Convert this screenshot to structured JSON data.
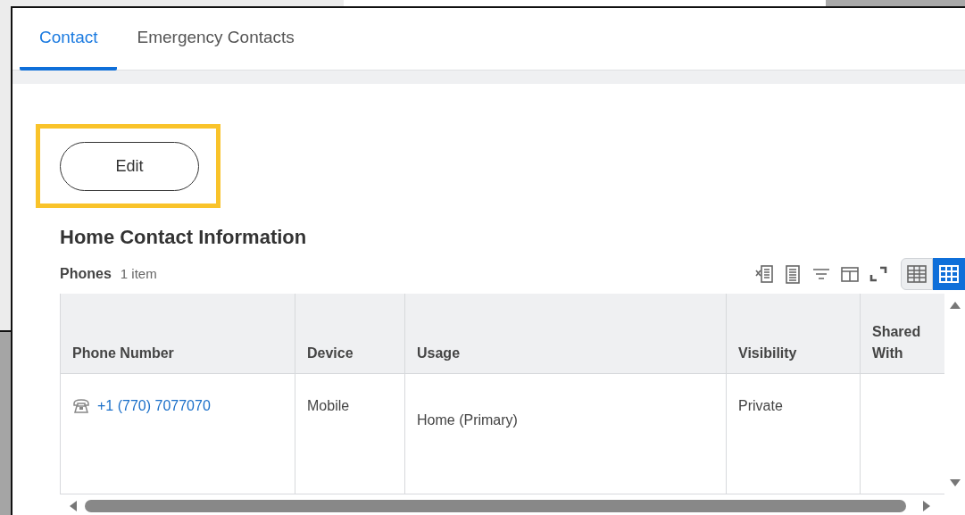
{
  "tabs": [
    {
      "label": "Contact",
      "selected": true
    },
    {
      "label": "Emergency Contacts",
      "selected": false
    }
  ],
  "edit_button": {
    "label": "Edit",
    "highlighted": true
  },
  "section": {
    "title": "Home Contact Information"
  },
  "phones": {
    "label": "Phones",
    "count": "1 item",
    "view_toggle": [
      {
        "kind": "list",
        "selected": false
      },
      {
        "kind": "grid",
        "selected": true
      }
    ],
    "table": {
      "columns": [
        "Phone Number",
        "Device",
        "Usage",
        "Visibility",
        "Shared With"
      ],
      "rows": [
        {
          "cells": [
            "+1 (770) 7077070",
            "Mobile",
            "Home (Primary)",
            "Private"
          ]
        }
      ]
    }
  }
}
